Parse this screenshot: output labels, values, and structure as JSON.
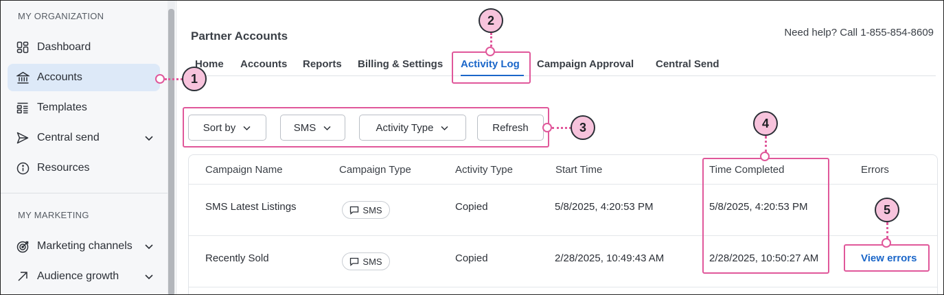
{
  "sidebar": {
    "org_label": "MY ORGANIZATION",
    "marketing_label": "MY MARKETING",
    "items": [
      {
        "label": "Dashboard",
        "icon": "dashboard-icon"
      },
      {
        "label": "Accounts",
        "icon": "bank-icon",
        "active": true
      },
      {
        "label": "Templates",
        "icon": "templates-icon"
      },
      {
        "label": "Central send",
        "icon": "send-icon",
        "expandable": true
      },
      {
        "label": "Resources",
        "icon": "info-icon"
      },
      {
        "label": "Marketing channels",
        "icon": "target-icon",
        "expandable": true
      },
      {
        "label": "Audience growth",
        "icon": "arrow-up-right-icon",
        "expandable": true
      }
    ]
  },
  "header": {
    "title": "Partner Accounts",
    "help": "Need help? Call 1-855-854-8609"
  },
  "tabs": [
    {
      "label": "Home"
    },
    {
      "label": "Accounts"
    },
    {
      "label": "Reports"
    },
    {
      "label": "Billing & Settings"
    },
    {
      "label": "Activity Log",
      "active": true
    },
    {
      "label": "Campaign Approval"
    },
    {
      "label": "Central Send"
    }
  ],
  "filters": {
    "sort_by": "Sort by",
    "channel": "SMS",
    "activity_type": "Activity Type",
    "refresh": "Refresh"
  },
  "table": {
    "columns": [
      "Campaign Name",
      "Campaign Type",
      "Activity Type",
      "Start Time",
      "Time Completed",
      "Errors"
    ],
    "rows": [
      {
        "campaign_name": "SMS Latest Listings",
        "campaign_type": "SMS",
        "activity_type": "Copied",
        "start_time": "5/8/2025, 4:20:53 PM",
        "time_completed": "5/8/2025, 4:20:53 PM",
        "errors": ""
      },
      {
        "campaign_name": "Recently Sold",
        "campaign_type": "SMS",
        "activity_type": "Copied",
        "start_time": "2/28/2025, 10:49:43 AM",
        "time_completed": "2/28/2025, 10:50:27 AM",
        "errors": "View errors"
      }
    ]
  },
  "callouts": [
    "1",
    "2",
    "3",
    "4",
    "5"
  ],
  "colors": {
    "accent": "#1a66c9",
    "highlight": "#e0579a",
    "callout_fill": "#f7c3dc",
    "active_nav": "#dde9f8"
  }
}
